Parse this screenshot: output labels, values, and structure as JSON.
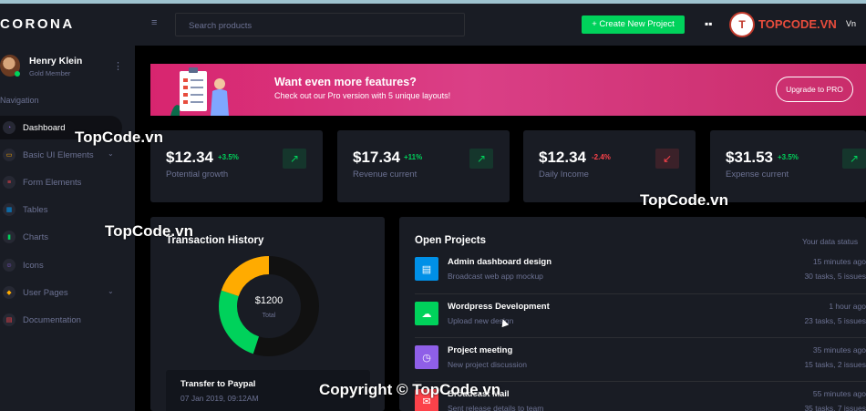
{
  "app": {
    "brand": "CORONA"
  },
  "profile": {
    "name": "Henry Klein",
    "role": "Gold Member"
  },
  "sidebar": {
    "section_title": "Navigation",
    "items": [
      {
        "label": "Dashboard",
        "icon": "speedometer-icon",
        "active": true
      },
      {
        "label": "Basic UI Elements",
        "icon": "laptop-icon",
        "has_submenu": true
      },
      {
        "label": "Form Elements",
        "icon": "playlist-icon"
      },
      {
        "label": "Tables",
        "icon": "table-icon"
      },
      {
        "label": "Charts",
        "icon": "chart-bar-icon"
      },
      {
        "label": "Icons",
        "icon": "contacts-icon"
      },
      {
        "label": "User Pages",
        "icon": "security-icon",
        "has_submenu": true
      },
      {
        "label": "Documentation",
        "icon": "file-document-icon"
      }
    ]
  },
  "topbar": {
    "search_placeholder": "Search products",
    "create_button": "+ Create New Project",
    "user_fragment": "Vn",
    "logo_text": "TOPCODE.VN"
  },
  "banner": {
    "title": "Want even more features?",
    "subtitle": "Check out our Pro version with 5 unique layouts!",
    "button": "Upgrade to PRO"
  },
  "stats": [
    {
      "value": "$12.34",
      "delta": "+3.5%",
      "trend": "up",
      "label": "Potential growth"
    },
    {
      "value": "$17.34",
      "delta": "+11%",
      "trend": "up",
      "label": "Revenue current"
    },
    {
      "value": "$12.34",
      "delta": "-2.4%",
      "trend": "down",
      "label": "Daily Income"
    },
    {
      "value": "$31.53",
      "delta": "+3.5%",
      "trend": "up",
      "label": "Expense current"
    }
  ],
  "transaction": {
    "title": "Transaction History",
    "center_value": "$1200",
    "center_label": "Total",
    "segments": [
      {
        "value": 55,
        "color": "#111111"
      },
      {
        "value": 25,
        "color": "#00d25b"
      },
      {
        "value": 20,
        "color": "#ffab00"
      }
    ],
    "items": [
      {
        "title": "Transfer to Paypal",
        "date": "07 Jan 2019, 09:12AM"
      }
    ]
  },
  "projects": {
    "title": "Open Projects",
    "right_label": "Your data status",
    "items": [
      {
        "title": "Admin dashboard design",
        "subtitle": "Broadcast web app mockup",
        "time": "15 minutes ago",
        "tasks": "30 tasks, 5 issues",
        "color": "#0090e7",
        "icon": "file-icon"
      },
      {
        "title": "Wordpress Development",
        "subtitle": "Upload new design",
        "time": "1 hour ago",
        "tasks": "23 tasks, 5 issues",
        "color": "#00d25b",
        "icon": "cloud-download-icon"
      },
      {
        "title": "Project meeting",
        "subtitle": "New project discussion",
        "time": "35 minutes ago",
        "tasks": "15 tasks, 2 issues",
        "color": "#8f5fe8",
        "icon": "clock-icon"
      },
      {
        "title": "Broadcast Mail",
        "subtitle": "Sent release details to team",
        "time": "55 minutes ago",
        "tasks": "35 tasks, 7 issues",
        "color": "#fc424a",
        "icon": "email-icon"
      }
    ]
  },
  "watermarks": [
    "TopCode.vn",
    "TopCode.vn",
    "TopCode.vn",
    "Copyright © TopCode.vn"
  ]
}
